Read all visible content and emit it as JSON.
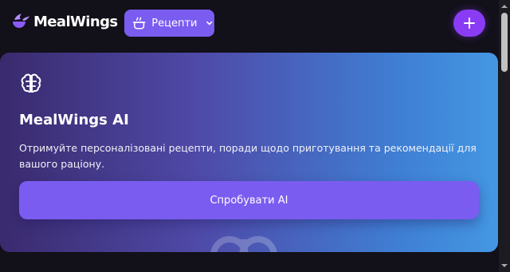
{
  "header": {
    "logo_text": "MealWings",
    "logo_icon": "winged-bowl-icon",
    "dropdown": {
      "label": "Рецепти",
      "icon": "cooking-pot-icon"
    },
    "add_button_icon": "plus-icon"
  },
  "ai_card": {
    "icon": "brain-icon",
    "title": "MealWings AI",
    "description": "Отримуйте персоналізовані рецепти, поради щодо приготування та рекомендації для вашого раціону.",
    "button_label": "Спробувати AI"
  },
  "colors": {
    "brand_purple": "#7a5cf0",
    "add_button": "#8a3cf5",
    "background": "#121018"
  }
}
